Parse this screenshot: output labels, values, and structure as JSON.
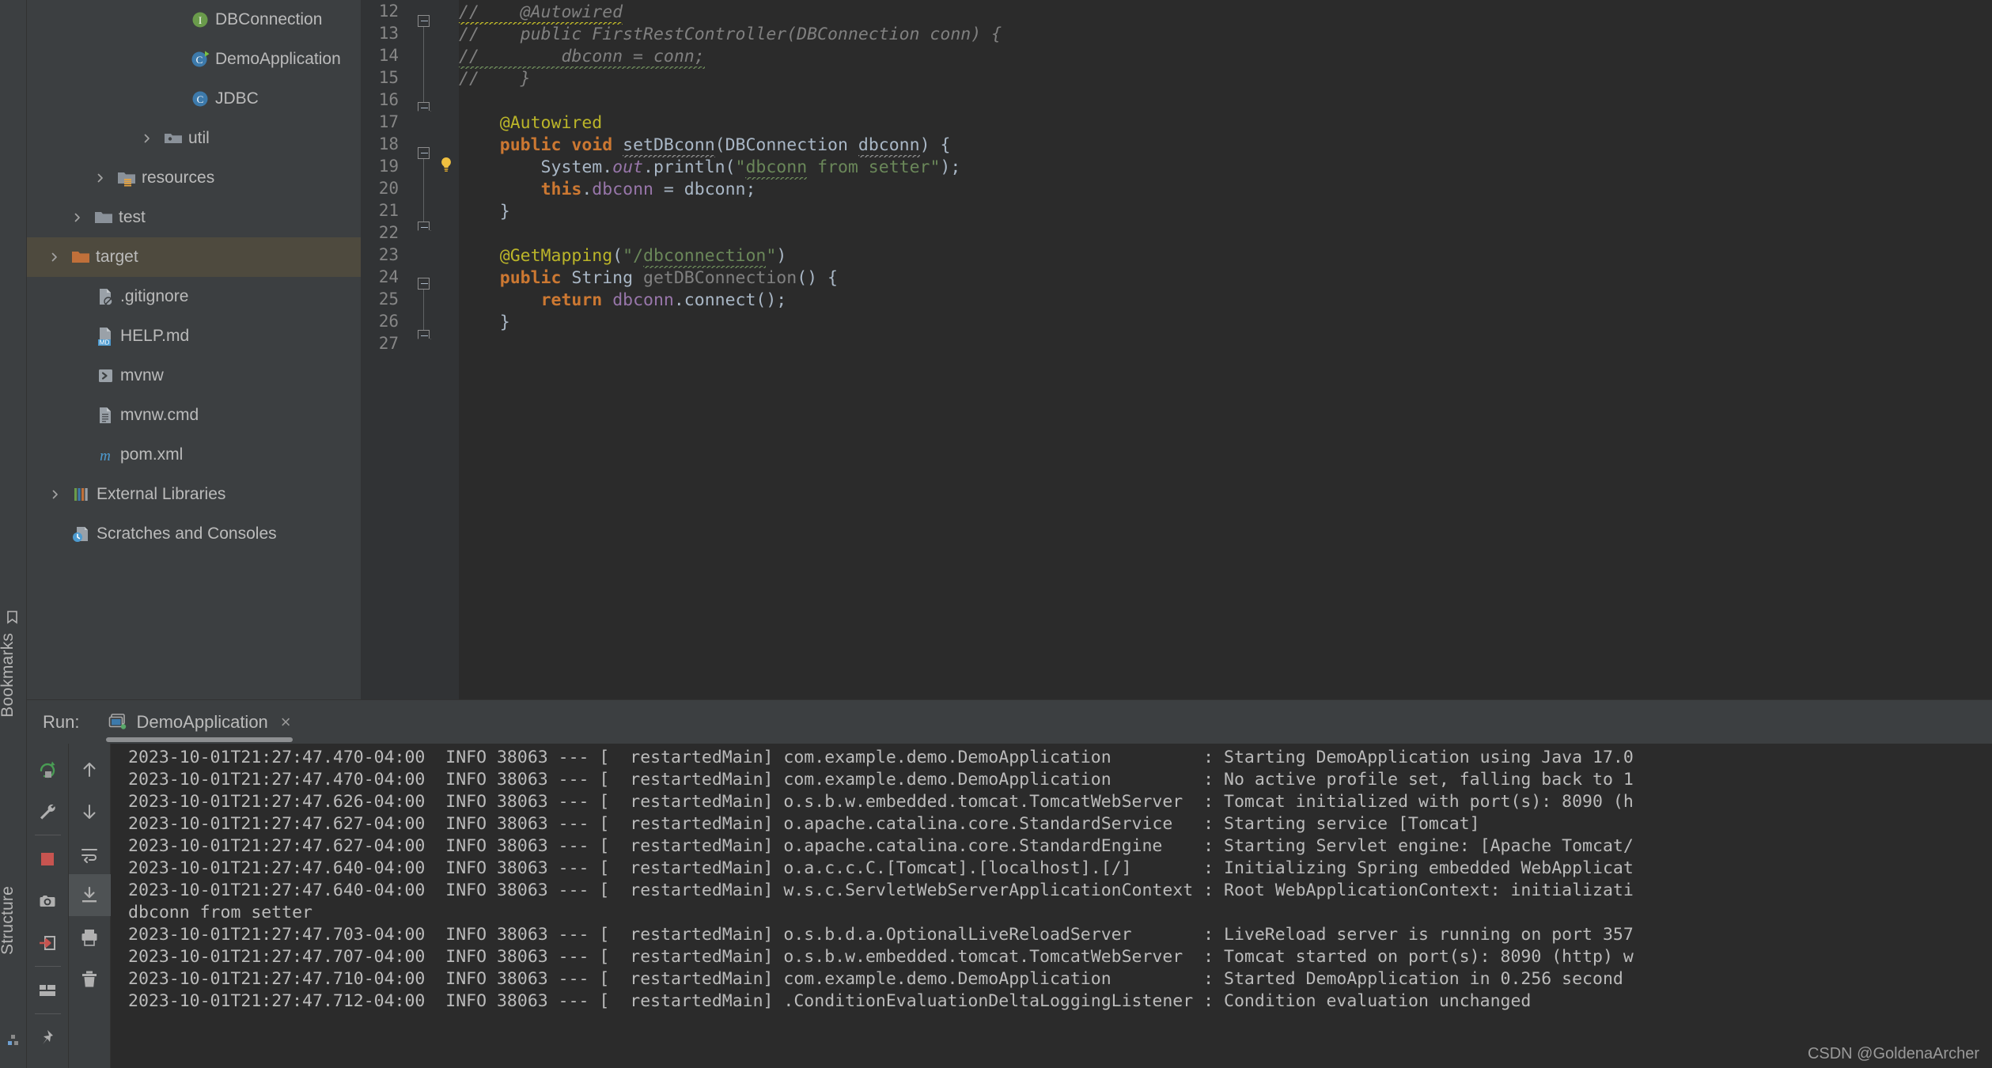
{
  "left_strip": {
    "bookmarks_label": "Bookmarks",
    "structure_label": "Structure"
  },
  "project_tree": {
    "items": [
      {
        "label": "DBConnection",
        "icon": "interface-icon",
        "indent": 206,
        "arrow": "none",
        "selected": false
      },
      {
        "label": "DemoApplication",
        "icon": "class-run-icon",
        "indent": 206,
        "arrow": "none",
        "selected": false
      },
      {
        "label": "JDBC",
        "icon": "class-icon",
        "indent": 206,
        "arrow": "none",
        "selected": false
      },
      {
        "label": "util",
        "icon": "package-folder-icon",
        "indent": 172,
        "arrow": "collapsed",
        "selected": false
      },
      {
        "label": "resources",
        "icon": "resources-folder-icon",
        "indent": 113,
        "arrow": "collapsed",
        "selected": false
      },
      {
        "label": "test",
        "icon": "folder-icon",
        "indent": 84,
        "arrow": "collapsed",
        "selected": false
      },
      {
        "label": "target",
        "icon": "target-folder-icon",
        "indent": 55,
        "arrow": "collapsed",
        "selected": true
      },
      {
        "label": ".gitignore",
        "icon": "gitignore-file-icon",
        "indent": 86,
        "arrow": "none",
        "selected": false
      },
      {
        "label": "HELP.md",
        "icon": "markdown-file-icon",
        "indent": 86,
        "arrow": "none",
        "selected": false
      },
      {
        "label": "mvnw",
        "icon": "shell-script-icon",
        "indent": 86,
        "arrow": "none",
        "selected": false
      },
      {
        "label": "mvnw.cmd",
        "icon": "cmd-file-icon",
        "indent": 86,
        "arrow": "none",
        "selected": false
      },
      {
        "label": "pom.xml",
        "icon": "maven-file-icon",
        "indent": 86,
        "arrow": "none",
        "selected": false
      },
      {
        "label": "External Libraries",
        "icon": "library-icon",
        "indent": 56,
        "arrow": "collapsed",
        "selected": false
      },
      {
        "label": "Scratches and Consoles",
        "icon": "scratches-icon",
        "indent": 56,
        "arrow": "none",
        "selected": false
      }
    ]
  },
  "editor": {
    "line_numbers": [
      "12",
      "13",
      "14",
      "15",
      "16",
      "17",
      "18",
      "19",
      "20",
      "21",
      "22",
      "23",
      "24",
      "25",
      "26",
      "27"
    ],
    "lines": [
      {
        "n": "12",
        "segments": [
          {
            "t": "//    @Autowired",
            "c": "c-comment wavy-y"
          }
        ]
      },
      {
        "n": "13",
        "segments": [
          {
            "t": "//    public FirstRestController(DBConnection conn) {",
            "c": "c-comment"
          }
        ]
      },
      {
        "n": "14",
        "segments": [
          {
            "t": "//        dbconn = conn;",
            "c": "c-comment wavy-g"
          }
        ]
      },
      {
        "n": "15",
        "segments": [
          {
            "t": "//    }",
            "c": "c-comment"
          }
        ]
      },
      {
        "n": "16",
        "segments": []
      },
      {
        "n": "17",
        "segments": [
          {
            "t": "    @Autowired",
            "c": "c-anno"
          }
        ]
      },
      {
        "n": "18",
        "segments": [
          {
            "t": "    ",
            "c": "c-plain"
          },
          {
            "t": "public",
            "c": "c-kw"
          },
          {
            "t": " ",
            "c": "c-plain"
          },
          {
            "t": "void",
            "c": "c-kw"
          },
          {
            "t": " ",
            "c": "c-plain"
          },
          {
            "t": "setDBconn",
            "c": "c-method wavy-w"
          },
          {
            "t": "(",
            "c": "c-plain"
          },
          {
            "t": "DBConnection",
            "c": "c-type"
          },
          {
            "t": " ",
            "c": "c-plain"
          },
          {
            "t": "dbconn",
            "c": "c-plain wavy-w"
          },
          {
            "t": ") {",
            "c": "c-plain"
          }
        ]
      },
      {
        "n": "19",
        "segments": [
          {
            "t": "        System",
            "c": "c-plain"
          },
          {
            "t": ".",
            "c": "c-plain"
          },
          {
            "t": "out",
            "c": "c-static"
          },
          {
            "t": ".println(",
            "c": "c-plain"
          },
          {
            "t": "\"",
            "c": "c-str"
          },
          {
            "t": "dbconn",
            "c": "c-str wavy-g"
          },
          {
            "t": " from setter\"",
            "c": "c-str"
          },
          {
            "t": ");",
            "c": "c-plain"
          }
        ]
      },
      {
        "n": "20",
        "segments": [
          {
            "t": "        ",
            "c": "c-plain"
          },
          {
            "t": "this",
            "c": "c-kw"
          },
          {
            "t": ".",
            "c": "c-plain"
          },
          {
            "t": "dbconn",
            "c": "c-field"
          },
          {
            "t": " = dbconn;",
            "c": "c-plain"
          }
        ]
      },
      {
        "n": "21",
        "segments": [
          {
            "t": "    }",
            "c": "c-plain"
          }
        ]
      },
      {
        "n": "22",
        "segments": []
      },
      {
        "n": "23",
        "segments": [
          {
            "t": "    @GetMapping",
            "c": "c-anno"
          },
          {
            "t": "(",
            "c": "c-plain"
          },
          {
            "t": "\"/",
            "c": "c-str"
          },
          {
            "t": "dbconnection",
            "c": "c-str wavy-g"
          },
          {
            "t": "\"",
            "c": "c-str"
          },
          {
            "t": ")",
            "c": "c-plain"
          }
        ]
      },
      {
        "n": "24",
        "segments": [
          {
            "t": "    ",
            "c": "c-plain"
          },
          {
            "t": "public",
            "c": "c-kw"
          },
          {
            "t": " ",
            "c": "c-plain"
          },
          {
            "t": "String",
            "c": "c-type"
          },
          {
            "t": " ",
            "c": "c-plain"
          },
          {
            "t": "getDBConnection",
            "c": "c-methodg"
          },
          {
            "t": "() {",
            "c": "c-plain"
          }
        ]
      },
      {
        "n": "25",
        "segments": [
          {
            "t": "        ",
            "c": "c-plain"
          },
          {
            "t": "return",
            "c": "c-kw"
          },
          {
            "t": " ",
            "c": "c-plain"
          },
          {
            "t": "dbconn",
            "c": "c-field"
          },
          {
            "t": ".connect();",
            "c": "c-plain"
          }
        ]
      },
      {
        "n": "26",
        "segments": [
          {
            "t": "    }",
            "c": "c-plain"
          }
        ]
      },
      {
        "n": "27",
        "segments": []
      }
    ],
    "gutter_bulb_line": "19"
  },
  "run_window": {
    "label": "Run:",
    "tab_title": "DemoApplication",
    "tab_close": "×",
    "toolbar_a": [
      {
        "name": "rerun-icon"
      },
      {
        "name": "settings-wrench-icon"
      },
      {
        "name": "separator"
      },
      {
        "name": "stop-icon"
      },
      {
        "name": "camera-icon"
      },
      {
        "name": "export-icon"
      },
      {
        "name": "separator"
      },
      {
        "name": "layout-icon"
      },
      {
        "name": "separator"
      },
      {
        "name": "pin-icon"
      }
    ],
    "toolbar_b": [
      {
        "name": "up-arrow-icon"
      },
      {
        "name": "down-arrow-icon"
      },
      {
        "name": "soft-wrap-icon"
      },
      {
        "name": "scroll-to-end-icon",
        "active": true
      },
      {
        "name": "print-icon"
      },
      {
        "name": "trash-icon"
      }
    ],
    "console_lines": [
      "2023-10-01T21:27:47.470-04:00  INFO 38063 --- [  restartedMain] com.example.demo.DemoApplication         : Starting DemoApplication using Java 17.0",
      "2023-10-01T21:27:47.470-04:00  INFO 38063 --- [  restartedMain] com.example.demo.DemoApplication         : No active profile set, falling back to 1",
      "2023-10-01T21:27:47.626-04:00  INFO 38063 --- [  restartedMain] o.s.b.w.embedded.tomcat.TomcatWebServer  : Tomcat initialized with port(s): 8090 (h",
      "2023-10-01T21:27:47.627-04:00  INFO 38063 --- [  restartedMain] o.apache.catalina.core.StandardService   : Starting service [Tomcat]",
      "2023-10-01T21:27:47.627-04:00  INFO 38063 --- [  restartedMain] o.apache.catalina.core.StandardEngine    : Starting Servlet engine: [Apache Tomcat/",
      "2023-10-01T21:27:47.640-04:00  INFO 38063 --- [  restartedMain] o.a.c.c.C.[Tomcat].[localhost].[/]       : Initializing Spring embedded WebApplicat",
      "2023-10-01T21:27:47.640-04:00  INFO 38063 --- [  restartedMain] w.s.c.ServletWebServerApplicationContext : Root WebApplicationContext: initializati",
      "dbconn from setter",
      "2023-10-01T21:27:47.703-04:00  INFO 38063 --- [  restartedMain] o.s.b.d.a.OptionalLiveReloadServer       : LiveReload server is running on port 357",
      "2023-10-01T21:27:47.707-04:00  INFO 38063 --- [  restartedMain] o.s.b.w.embedded.tomcat.TomcatWebServer  : Tomcat started on port(s): 8090 (http) w",
      "2023-10-01T21:27:47.710-04:00  INFO 38063 --- [  restartedMain] com.example.demo.DemoApplication         : Started DemoApplication in 0.256 second",
      "2023-10-01T21:27:47.712-04:00  INFO 38063 --- [  restartedMain] .ConditionEvaluationDeltaLoggingListener : Condition evaluation unchanged"
    ],
    "watermark": "CSDN @GoldenaArcher"
  },
  "colors": {
    "panel_bg": "#3c3f41",
    "editor_bg": "#2b2b2b",
    "gutter_bg": "#313335",
    "selection_bg": "#4e4a3e",
    "text": "#bbbbbb",
    "annotation": "#bbb529",
    "keyword": "#cc7832",
    "string": "#6a8759",
    "field": "#9876aa",
    "comment": "#808080",
    "folder_orange": "#c0703a",
    "run_green": "#499c54",
    "stop_red": "#c75450"
  }
}
